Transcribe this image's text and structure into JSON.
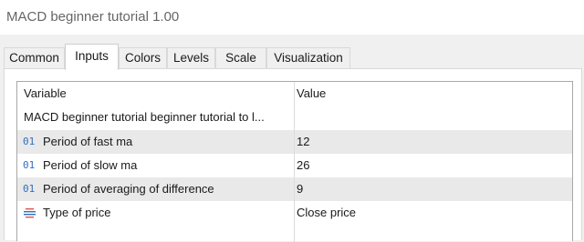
{
  "window": {
    "title": "MACD beginner tutorial 1.00"
  },
  "tabs": [
    {
      "label": "Common",
      "active": false
    },
    {
      "label": "Inputs",
      "active": true
    },
    {
      "label": "Colors",
      "active": false
    },
    {
      "label": "Levels",
      "active": false
    },
    {
      "label": "Scale",
      "active": false
    },
    {
      "label": "Visualization",
      "active": false
    }
  ],
  "grid": {
    "headers": {
      "variable": "Variable",
      "value": "Value"
    },
    "rows": [
      {
        "variable": "MACD beginner tutorial beginner tutorial to l...",
        "value": "",
        "icon": ""
      },
      {
        "variable": "Period of fast ma",
        "value": "12",
        "icon": "integer-01-icon",
        "icon_text": "01"
      },
      {
        "variable": "Period of slow ma",
        "value": "26",
        "icon": "integer-01-icon",
        "icon_text": "01"
      },
      {
        "variable": "Period of averaging of difference",
        "value": "9",
        "icon": "integer-01-icon",
        "icon_text": "01"
      },
      {
        "variable": "Type of price",
        "value": "Close price",
        "icon": "enumeration-list-icon"
      }
    ]
  },
  "colors": {
    "accent_icon": "#2f6fc0",
    "enum_icon_red": "#d9534f",
    "row_shade": "#e9e9e9"
  }
}
